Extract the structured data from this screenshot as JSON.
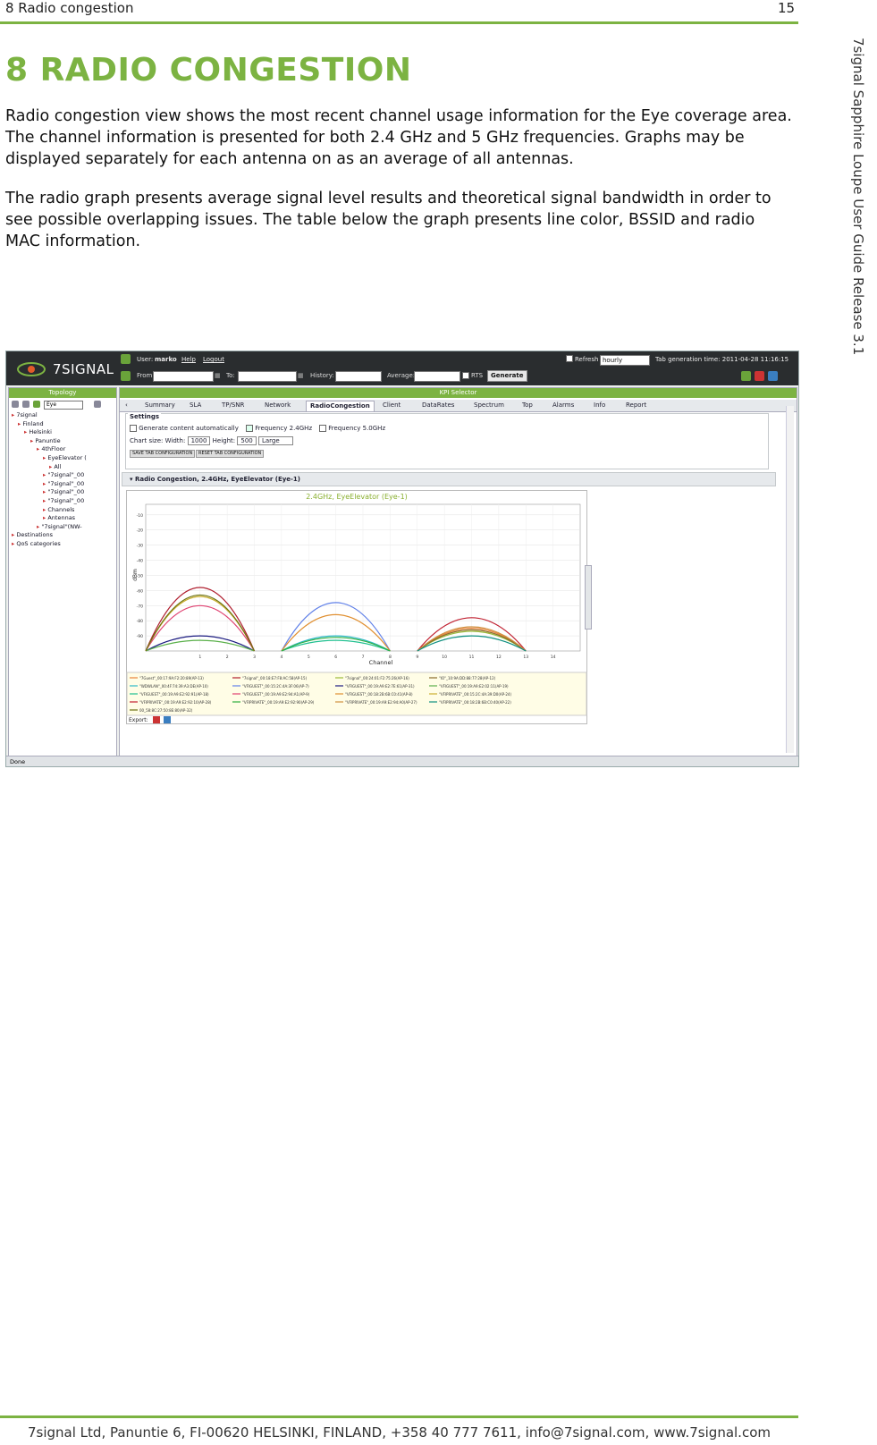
{
  "page": {
    "header_left": "8 Radio congestion",
    "header_right": "15",
    "side_title": "7signal Sapphire Loupe User Guide Release 3.1",
    "chapter_title": "8 RADIO CONGESTION",
    "paragraphs": [
      "Radio congestion view shows the most recent channel usage information for the Eye coverage area. The channel information is presented for both 2.4 GHz and 5 GHz frequencies. Graphs may be displayed separately for each antenna on as an average of all antennas.",
      "The radio graph presents average signal level results and theoretical signal bandwidth in order to see possible overlapping issues. The table below the graph presents line color, BSSID and radio MAC information."
    ],
    "footer": "7signal Ltd, Panuntie 6, FI-00620 HELSINKI, FINLAND, +358 40 777 7611, info@7signal.com, www.7signal.com",
    "accent_color": "#7cb342"
  },
  "app": {
    "logo_text": "7SIGNAL",
    "topbar": {
      "user_label": "User:",
      "user_name": "marko",
      "help": "Help",
      "logout": "Logout",
      "refresh_label": "Refresh",
      "refresh_value": "hourly",
      "generation_time": "Tab generation time: 2011-04-28 11:16:15",
      "from_label": "From:",
      "to_label": "To:",
      "history_label": "History:",
      "average_label": "Average:",
      "rts_label": "RTS",
      "generate_button": "Generate"
    },
    "left_panel": {
      "title": "Topology",
      "search_value": "Eye",
      "tree": [
        {
          "label": "7signal",
          "indent": 0
        },
        {
          "label": "Finland",
          "indent": 1
        },
        {
          "label": "Helsinki",
          "indent": 2
        },
        {
          "label": "Panuntie",
          "indent": 3
        },
        {
          "label": "4thFloor",
          "indent": 4
        },
        {
          "label": "EyeElevator (",
          "indent": 5
        },
        {
          "label": "All",
          "indent": 6
        },
        {
          "label": "\"7signal\"_00",
          "indent": 5
        },
        {
          "label": "\"7signal\"_00",
          "indent": 5
        },
        {
          "label": "\"7signal\"_00",
          "indent": 5
        },
        {
          "label": "\"7signal\"_00",
          "indent": 5
        },
        {
          "label": "Channels",
          "indent": 5
        },
        {
          "label": "Antennas",
          "indent": 5
        },
        {
          "label": "\"7signal\"(NW-",
          "indent": 4
        },
        {
          "label": "Destinations",
          "indent": 0
        },
        {
          "label": "QoS categories",
          "indent": 0
        }
      ]
    },
    "main_panel": {
      "title": "KPI Selector",
      "tabs": [
        "Summary",
        "SLA",
        "TP/SNR",
        "Network",
        "RadioCongestion",
        "Client",
        "DataRates",
        "Spectrum",
        "Top",
        "Alarms",
        "Info",
        "Report"
      ],
      "active_tab": "RadioCongestion",
      "settings": {
        "title": "Settings",
        "generate_auto": "Generate content automatically",
        "freq24": "Frequency 2.4GHz",
        "freq5": "Frequency 5.0GHz",
        "chart_size_label": "Chart size:",
        "width_label": "Width:",
        "width_value": "1000",
        "height_label": "Height:",
        "height_value": "500",
        "size_value": "Large",
        "save_button": "SAVE TAB CONFIGURATION",
        "reset_button": "RESET TAB CONFIGURATION"
      },
      "section_title": "Radio Congestion, 2.4GHz, EyeElevator (Eye-1)",
      "export_label": "Export:"
    },
    "status_text": "Done"
  },
  "chart_data": {
    "type": "line",
    "title": "2.4GHz, EyeElevator (Eye-1)",
    "xlabel": "Channel",
    "ylabel": "dBm",
    "xlim": [
      -1,
      15
    ],
    "ylim": [
      -100,
      -3
    ],
    "x_ticks": [
      1,
      2,
      3,
      4,
      5,
      6,
      7,
      8,
      9,
      10,
      11,
      12,
      13,
      14
    ],
    "y_ticks": [
      -10,
      -20,
      -30,
      -40,
      -50,
      -60,
      -70,
      -80,
      -90
    ],
    "series": [
      {
        "name": "\"7Guest\"_00:17:9A:F2:20:89(AP-13)",
        "color": "#e8833a",
        "center": 11,
        "peak": -85
      },
      {
        "name": "\"7signal\"_00:18:E7:F8:AC:58(AP-15)",
        "color": "#b02030",
        "center": 1,
        "peak": -58
      },
      {
        "name": "\"7signal\"_00:24:01:F2:75:26(AP-16)",
        "color": "#9bbb3a",
        "center": 11,
        "peak": -87
      },
      {
        "name": "\"IO\"_10:9A:DD:88:77:28(AP-12)",
        "color": "#8a6b2a",
        "center": 11,
        "peak": -86
      },
      {
        "name": "\"WDWLAN\"_00:4F:74:39:A3:DE(AP-10)",
        "color": "#2db8c8",
        "center": 6,
        "peak": -90
      },
      {
        "name": "\"VFIGUEST\"_00:15:2C:4A:3F:06(AP-7)",
        "color": "#6080e8",
        "center": 6,
        "peak": -68
      },
      {
        "name": "\"VFIGUEST\"_00:19:A9:E2:7E:61(AP-31)",
        "color": "#1a1a80",
        "center": 1,
        "peak": -90
      },
      {
        "name": "\"VFIGUEST\"_00:19:A9:E2:02:11(AP-19)",
        "color": "#5ab04a",
        "center": 1,
        "peak": -93
      },
      {
        "name": "\"VFIGUEST\"_00:19:A9:E2:92:91(AP-18)",
        "color": "#20c090",
        "center": 6,
        "peak": -93
      },
      {
        "name": "\"VFIGUEST\"_00:19:A9:E2:94:A1(AP-9)",
        "color": "#e04070",
        "center": 1,
        "peak": -70
      },
      {
        "name": "\"VFIGUEST\"_00:18:2B:6B:C0:41(AP-8)",
        "color": "#e08f30",
        "center": 6,
        "peak": -76
      },
      {
        "name": "\"VFIPRIVATE\"_00:15:2C:4A:39:D0(AP-24)",
        "color": "#cbb030",
        "center": 1,
        "peak": -64
      },
      {
        "name": "\"VFIPRIVATE\"_00:19:A9:E2:92:10(AP-28)",
        "color": "#c02030",
        "center": 11,
        "peak": -78
      },
      {
        "name": "\"VFIPRIVATE\"_00:19:A9:E2:92:90(AP-29)",
        "color": "#30b040",
        "center": 6,
        "peak": -91
      },
      {
        "name": "\"VFIPRIVATE\"_00:19:A9:E2:94:A0(AP-27)",
        "color": "#d09040",
        "center": 11,
        "peak": -84
      },
      {
        "name": "\"VFIPRIVATE\"_00:18:2B:6B:C0:40(AP-22)",
        "color": "#109080",
        "center": 11,
        "peak": -90
      },
      {
        "name": "00_58:8C:27:50:8E:80(AP-32)",
        "color": "#6b7010",
        "center": 1,
        "peak": -63
      }
    ]
  }
}
